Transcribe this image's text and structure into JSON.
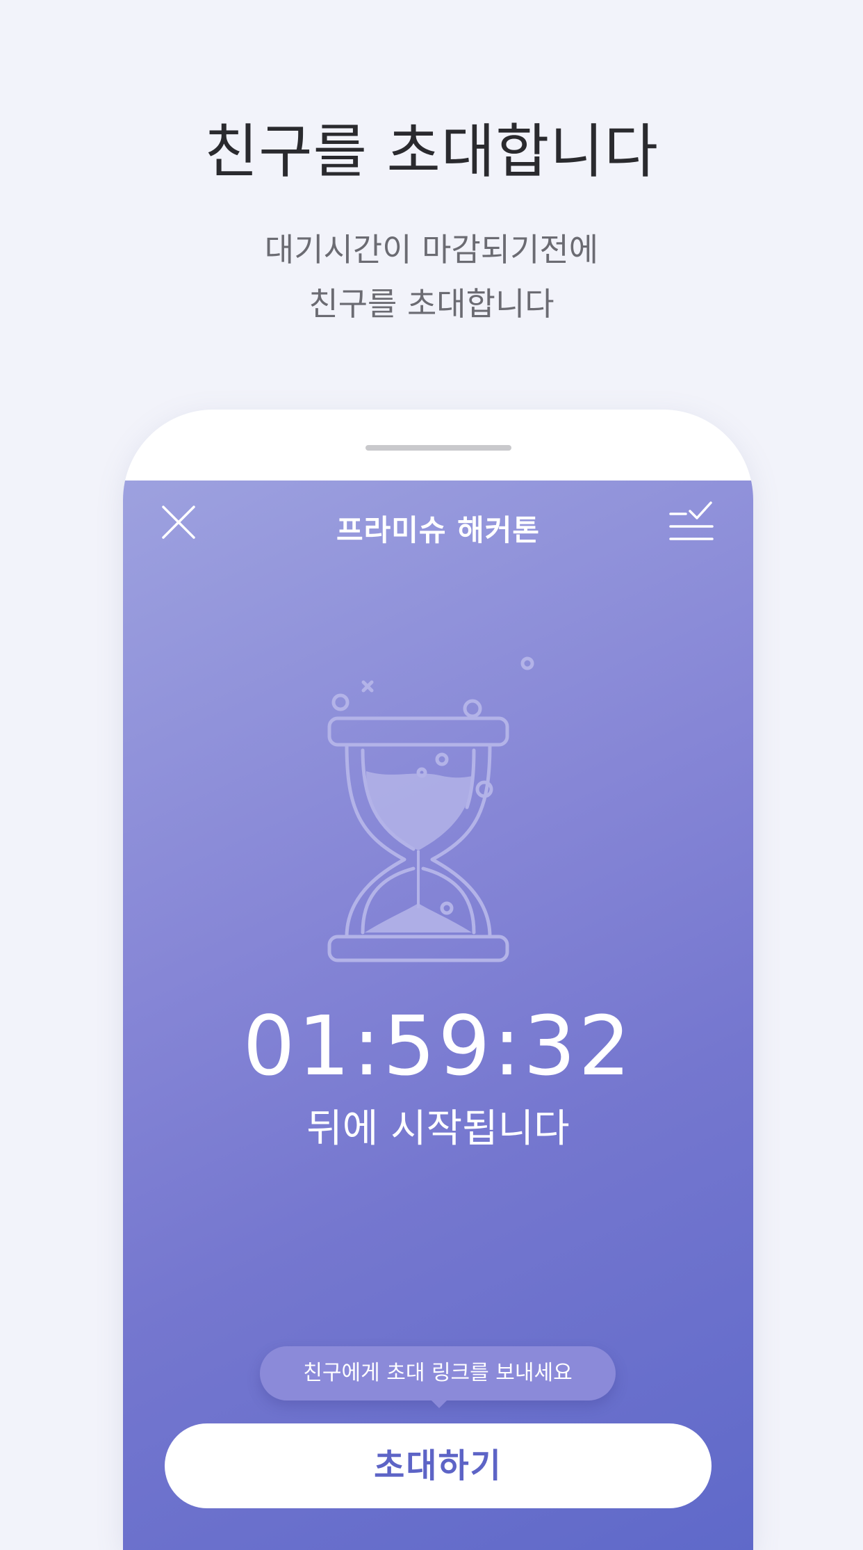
{
  "page": {
    "headline": "친구를 초대합니다",
    "subtitle_lines": [
      "대기시간이 마감되기전에",
      "친구를 초대합니다"
    ]
  },
  "app": {
    "title": "프라미슈 해커톤",
    "close_icon": "close-icon",
    "checklist_icon": "checklist-icon",
    "illustration": "hourglass-icon"
  },
  "countdown": {
    "time": "01:59:32",
    "caption": "뒤에 시작됩니다"
  },
  "invite": {
    "tooltip": "친구에게 초대 링크를 보내세요",
    "button_label": "초대하기"
  },
  "colors": {
    "background": "#f2f3fa",
    "screen_gradient_start": "#9da1df",
    "screen_gradient_end": "#5f69c9",
    "button_text": "#5d64c6",
    "tooltip": "#8b8ad9"
  }
}
